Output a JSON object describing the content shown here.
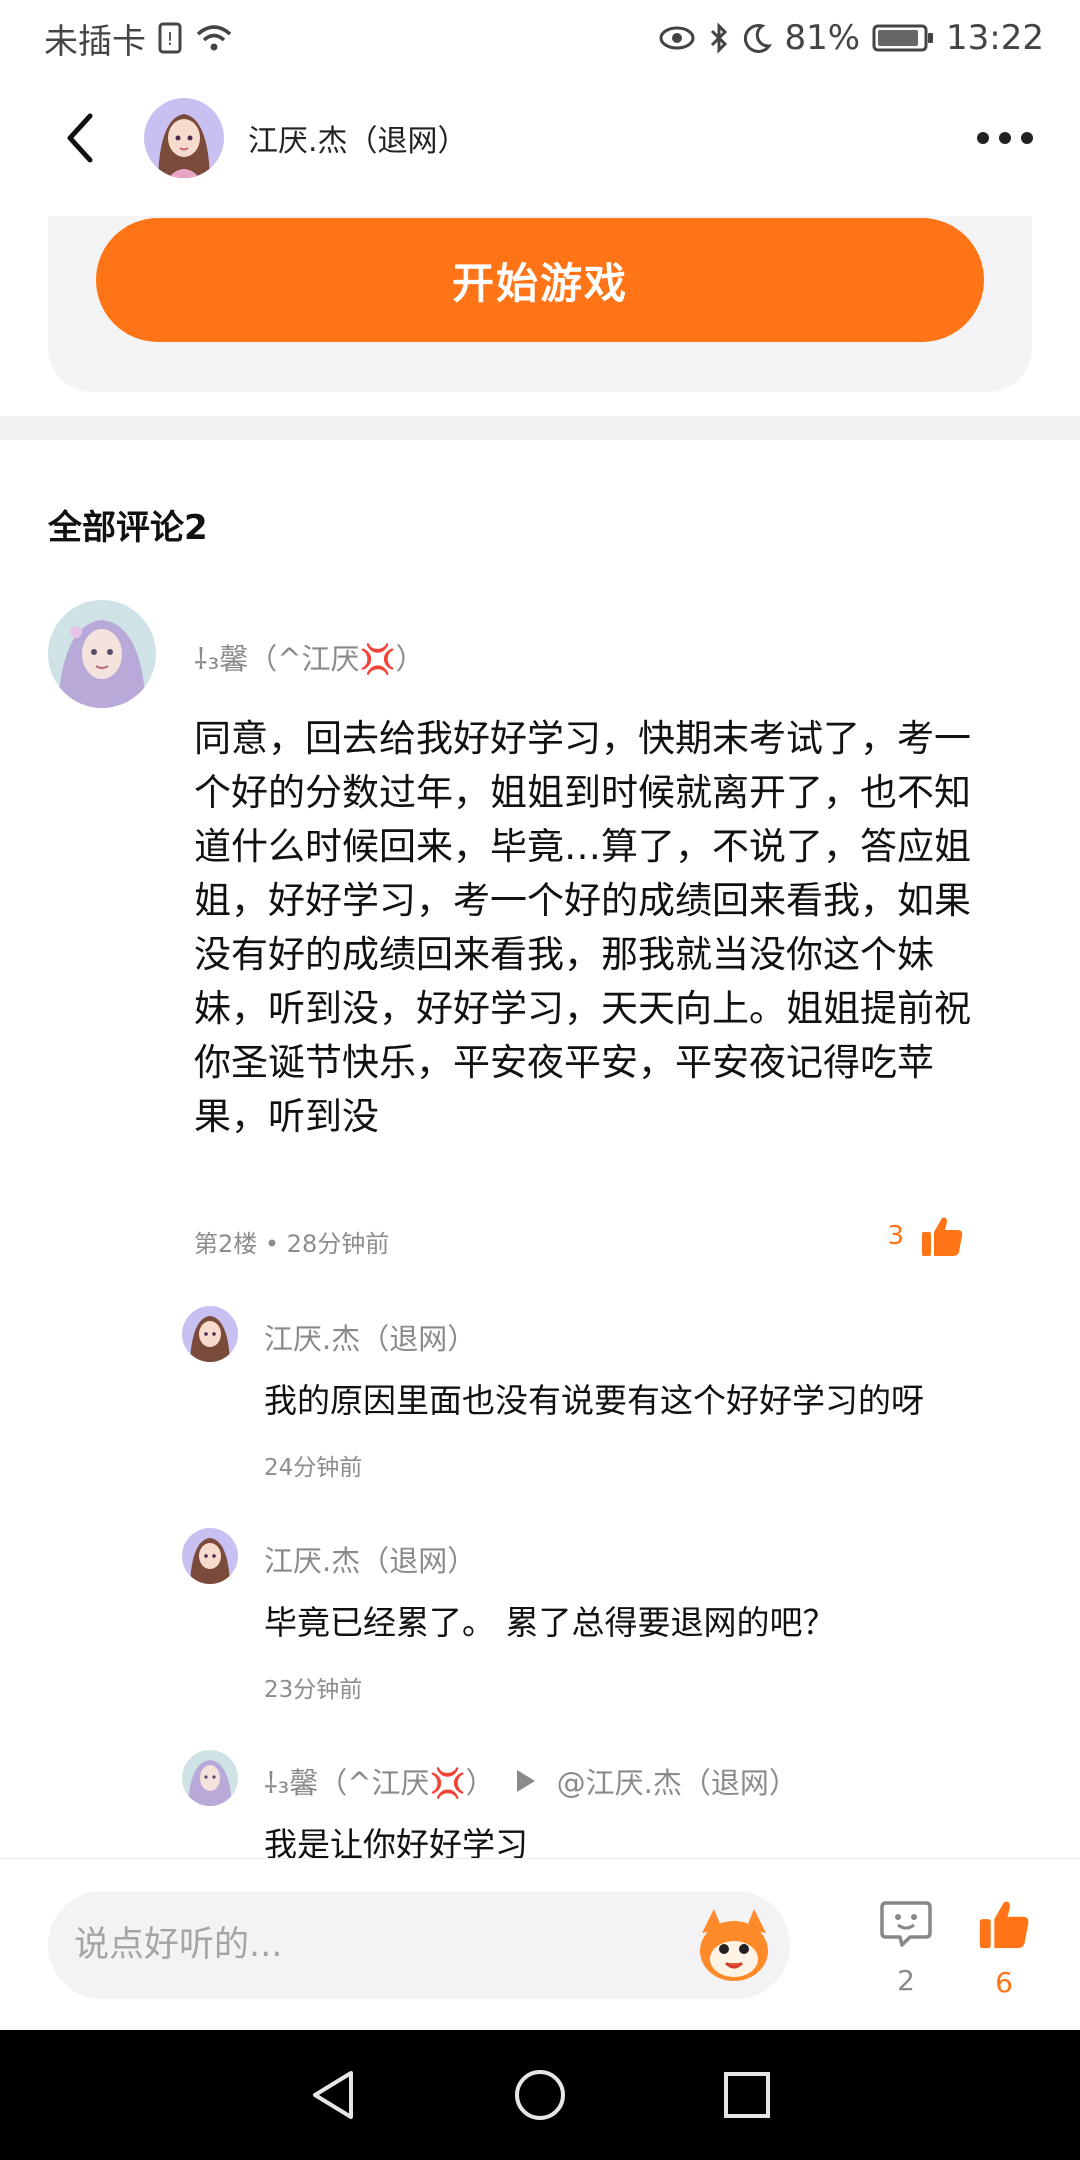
{
  "status_bar": {
    "carrier": "未插卡",
    "battery": "81%",
    "time": "13:22"
  },
  "header": {
    "author_name": "江厌.杰（退网）"
  },
  "game_card": {
    "start_label": "开始游戏"
  },
  "comments": {
    "title": "全部评论2",
    "main": {
      "user": "⸸₃馨（^江厌💢）",
      "body": "同意，回去给我好好学习，快期末考试了，考一个好的分数过年，姐姐到时候就离开了，也不知道什么时候回来，毕竟…算了，不说了，答应姐姐，好好学习，考一个好的成绩回来看我，如果没有好的成绩回来看我，那我就当没你这个妹妹，听到没，好好学习，天天向上。姐姐提前祝你圣诞节快乐，平安夜平安，平安夜记得吃苹果，听到没",
      "meta": "第2楼 • 28分钟前",
      "likes": "3"
    },
    "replies": [
      {
        "user": "江厌.杰（退网）",
        "text": "我的原因里面也没有说要有这个好好学习的呀",
        "time": "24分钟前"
      },
      {
        "user": "江厌.杰（退网）",
        "text": "毕竟已经累了。 累了总得要退网的吧？",
        "time": "23分钟前"
      },
      {
        "user": "⸸₃馨（^江厌💢）",
        "target": "@江厌.杰（退网）",
        "text": "我是让你好好学习"
      }
    ]
  },
  "input_bar": {
    "placeholder": "说点好听的...",
    "comment_count": "2",
    "like_count": "6"
  },
  "colors": {
    "accent": "#ff7417",
    "muted_text": "#8a8a8a",
    "card_bg": "#f4f4f6"
  },
  "icons": [
    "back-arrow-icon",
    "more-icon",
    "thumbs-up-icon",
    "comment-icon",
    "mascot-icon",
    "nav-back-icon",
    "nav-home-icon",
    "nav-recents-icon",
    "wifi-icon",
    "bluetooth-icon",
    "moon-icon",
    "battery-icon",
    "eye-icon",
    "sim-icon"
  ]
}
